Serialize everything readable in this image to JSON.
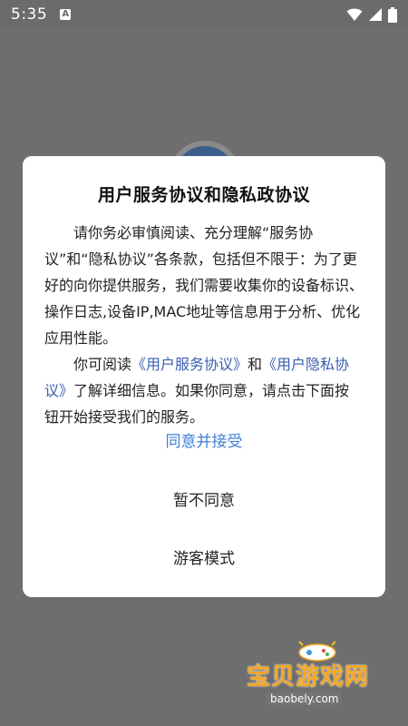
{
  "status_bar": {
    "time": "5:35",
    "notification_badge": "A"
  },
  "dialog": {
    "title": "用户服务协议和隐私政协议",
    "paragraph1": "请你务必审慎阅读、充分理解“服务协议”和“隐私协议”各条款，包括但不限于：为了更好的向你提供服务，我们需要收集你的设备标识、操作日志,设备IP,MAC地址等信息用于分析、优化应用性能。",
    "paragraph2_prefix": "你可阅读",
    "link_service": "《用户服务协议》",
    "paragraph2_and": "和",
    "link_privacy": "《用户隐私协议》",
    "paragraph2_suffix": "了解详细信息。如果你同意，请点击下面按钮开始接受我们的服务。",
    "accept_label": "同意并接受",
    "decline_label": "暂不同意",
    "guest_label": "游客模式"
  },
  "watermark": {
    "main_text": "宝贝游戏网",
    "sub_text": "baobely.com"
  },
  "colors": {
    "link": "#3a5fb0",
    "accept": "#3f7fd6",
    "watermark": "#f5a623"
  }
}
